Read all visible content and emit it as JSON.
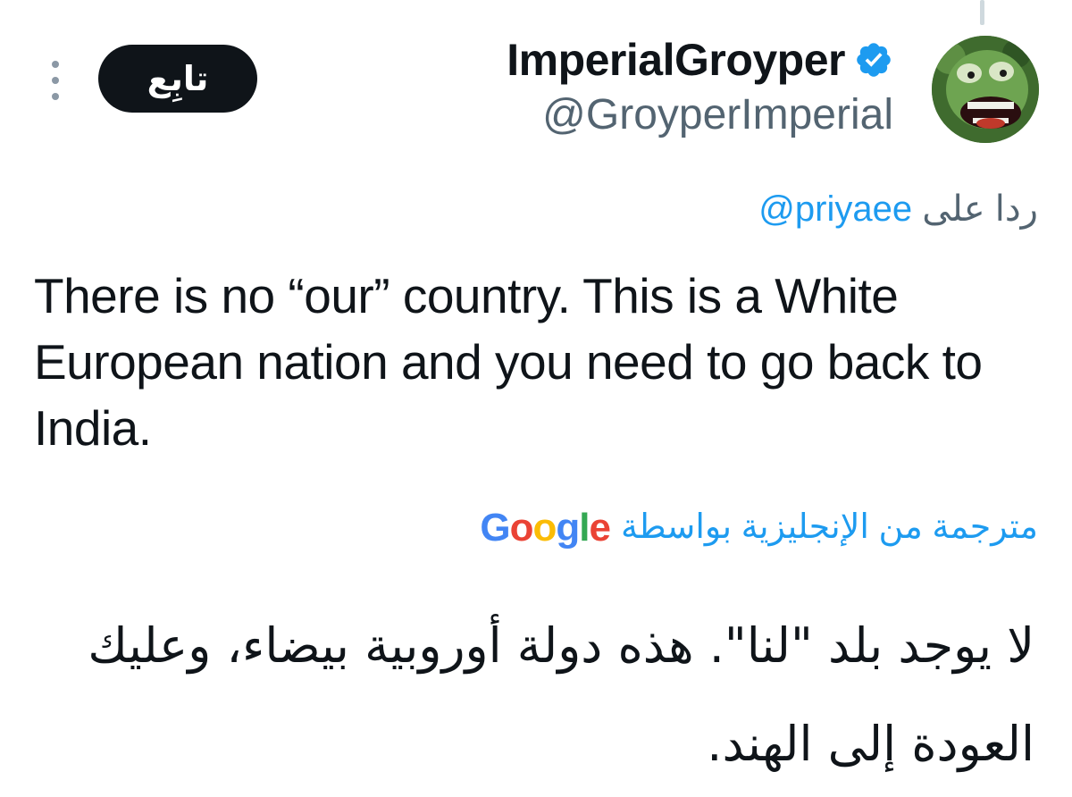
{
  "author": {
    "display_name": "ImperialGroyper",
    "handle": "@GroyperImperial",
    "verified": true,
    "avatar_icon": "frog-avatar"
  },
  "actions": {
    "follow_label": "تابِع",
    "more_icon": "vertical-ellipsis-icon"
  },
  "reply_context": {
    "prefix": "ردا على",
    "mention": "@priyaee"
  },
  "tweet": {
    "text": "There is no “our” country.  This is a White European nation and you need to go back to India."
  },
  "translation": {
    "label": "مترجمة من الإنجليزية بواسطة",
    "provider_logo_letters": [
      "G",
      "o",
      "o",
      "g",
      "l",
      "e"
    ],
    "text": "لا يوجد بلد \"لنا\". هذه دولة أوروبية بيضاء، وعليك العودة إلى الهند."
  },
  "colors": {
    "link_blue": "#1d9bf0",
    "secondary_text": "#536471",
    "primary_text": "#0f1419",
    "follow_button_bg": "#0f1419"
  }
}
